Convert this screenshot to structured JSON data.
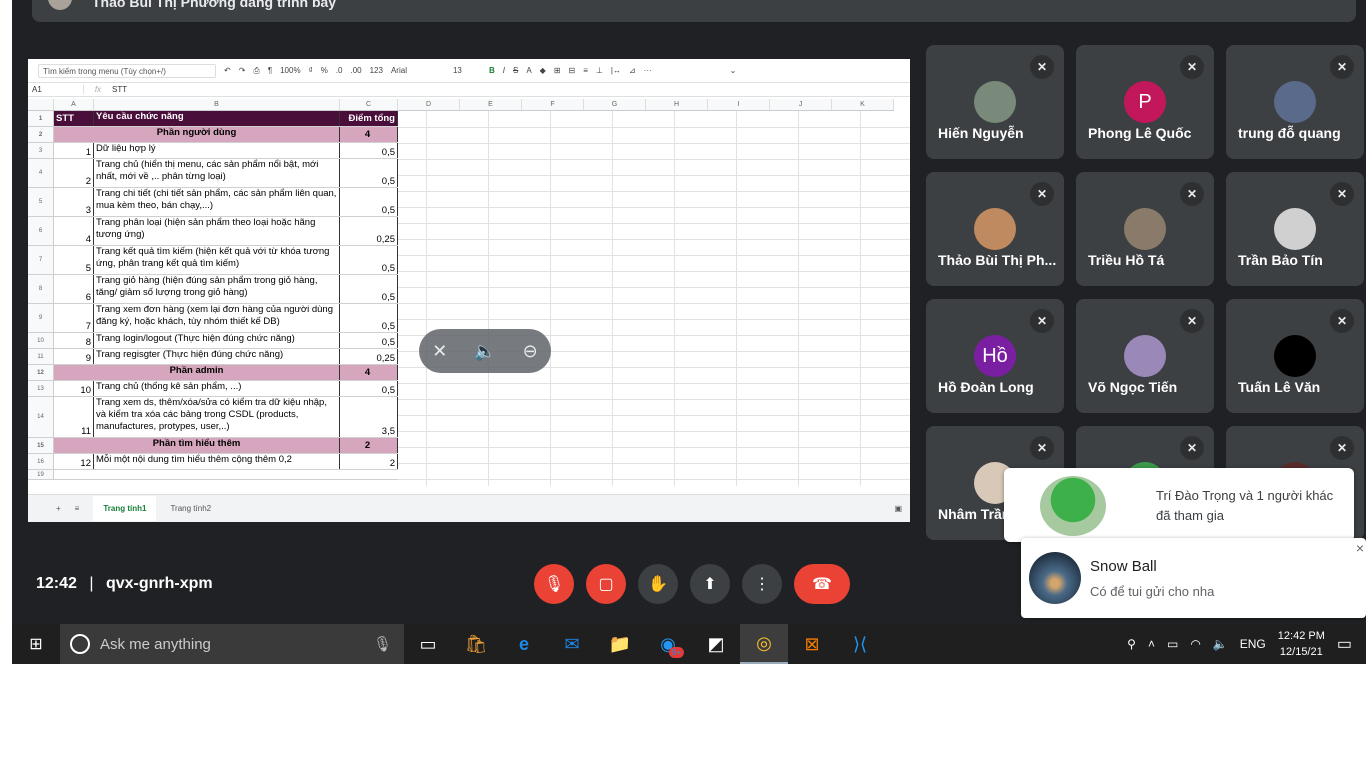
{
  "presenter": {
    "text": "Thảo Bùi Thị Phương đang trình bày"
  },
  "sheet": {
    "menu_search": "Tìm kiếm trong menu (Tùy chọn+/)",
    "zoom": "100%",
    "font": "Arial",
    "font_size": "13",
    "currency": "₫",
    "percent": "%",
    "dec_less": ".0",
    "dec_more": ".00",
    "num_format": "123",
    "cell_ref": "A1",
    "fx": "fx",
    "formula_value": "STT",
    "columns": [
      "A",
      "B",
      "C",
      "D",
      "E",
      "F",
      "G",
      "H",
      "I",
      "J",
      "K"
    ],
    "header": {
      "stt": "STT",
      "req": "Yêu cầu chức năng",
      "pt": "Điểm tổng"
    },
    "rows": [
      {
        "rn": "2",
        "type": "sec",
        "label": "Phần người dùng",
        "pt": "4"
      },
      {
        "rn": "3",
        "stt": "1",
        "req": "Dữ liệu hợp lý",
        "pt": "0,5",
        "h": 16
      },
      {
        "rn": "4",
        "stt": "2",
        "req": "Trang chủ (hiển thị menu, các sản phẩm nổi bật, mới nhất, mới về ,.. phân từng loại)",
        "pt": "0,5",
        "h": 29
      },
      {
        "rn": "5",
        "stt": "3",
        "req": "Trang chi tiết (chi tiết sản phẩm, các sản phẩm liên quan, mua kèm theo, bán chạy,...)",
        "pt": "0,5",
        "h": 29
      },
      {
        "rn": "6",
        "stt": "4",
        "req": "Trang phân loại (hiện sản phẩm theo loại hoặc hãng tương ứng)",
        "pt": "0,25",
        "h": 29
      },
      {
        "rn": "7",
        "stt": "5",
        "req": "Trang kết quả tìm kiếm (hiện kết quả với từ khóa tương ứng, phân trang kết quả tìm kiếm)",
        "pt": "0,5",
        "h": 29
      },
      {
        "rn": "8",
        "stt": "6",
        "req": "Trang giỏ hàng (hiện đúng sản phẩm trong giỏ hàng, tăng/ giảm số lượng trong giỏ hàng)",
        "pt": "0,5",
        "h": 29
      },
      {
        "rn": "9",
        "stt": "7",
        "req": "Trang xem đơn hàng (xem lại đơn hàng của người dùng đăng ký, hoặc khách, tùy nhóm thiết kế DB)",
        "pt": "0,5",
        "h": 29
      },
      {
        "rn": "10",
        "stt": "8",
        "req": "Trang login/logout (Thực hiện đúng chức năng)",
        "pt": "0,5",
        "h": 16
      },
      {
        "rn": "11",
        "stt": "9",
        "req": "Trang regisgter (Thực hiện đúng chức năng)",
        "pt": "0,25",
        "h": 16
      },
      {
        "rn": "12",
        "type": "sec",
        "label": "Phần admin",
        "pt": "4"
      },
      {
        "rn": "13",
        "stt": "10",
        "req": "Trang chủ (thống kê sản phẩm, ...)",
        "pt": "0,5",
        "h": 16
      },
      {
        "rn": "14",
        "stt": "11",
        "req": "Trang xem ds, thêm/xóa/sửa có kiểm tra dữ kiệu nhập, và kiểm tra xóa các bảng trong CSDL (products, manufactures, protypes, user,..)",
        "pt": "3,5",
        "h": 41
      },
      {
        "rn": "15",
        "type": "sec",
        "label": "Phần tìm hiểu thêm",
        "pt": "2"
      },
      {
        "rn": "16",
        "stt": "12",
        "req": "Mỗi một nội dung tìm hiểu thêm cộng thêm 0,2",
        "pt": "2",
        "h": 16
      },
      {
        "rn": "19",
        "type": "blank"
      }
    ],
    "tabs": [
      "Trang tính1",
      "Trang tính2"
    ],
    "add_sheet": "+",
    "all_sheets": "≡"
  },
  "participants": [
    {
      "name": "Hiến Nguyễn",
      "initial": "",
      "color": "#7a8a7a"
    },
    {
      "name": "Phong Lê Quốc",
      "initial": "P",
      "color": "#c2185b"
    },
    {
      "name": "trung đỗ quang",
      "initial": "",
      "color": "#5a6a8a"
    },
    {
      "name": "Thảo Bùi Thị Ph...",
      "initial": "",
      "color": "#c08a60"
    },
    {
      "name": "Triều Hồ Tá",
      "initial": "",
      "color": "#8a7a6a"
    },
    {
      "name": "Trần Bảo Tín",
      "initial": "",
      "color": "#d0d0d0"
    },
    {
      "name": "Hồ Đoàn Long",
      "initial": "Hồ",
      "color": "#7b1fa2"
    },
    {
      "name": "Võ Ngọc Tiến",
      "initial": "",
      "color": "#9a88b8"
    },
    {
      "name": "Tuấn Lê Văn",
      "initial": "",
      "color": "#000000"
    },
    {
      "name": "Nhâm Trần",
      "initial": "",
      "color": "#d8c8b8"
    },
    {
      "name": "",
      "initial": "",
      "color": "#3c9a4a"
    },
    {
      "name": "",
      "initial": "",
      "color": "#5a2a2a"
    }
  ],
  "meeting": {
    "time": "12:42",
    "divider": "|",
    "code": "qvx-gnrh-xpm"
  },
  "notifications": {
    "joined": "Trí Đào Trọng và 1 người khác đã tham gia",
    "chat_sender": "Snow Ball",
    "chat_message": "Có để tui gửi cho nha",
    "close": "×"
  },
  "taskbar": {
    "search_placeholder": "Ask me anything",
    "mail_badge": "5+",
    "lang": "ENG",
    "time": "12:42 PM",
    "date": "12/15/21"
  }
}
